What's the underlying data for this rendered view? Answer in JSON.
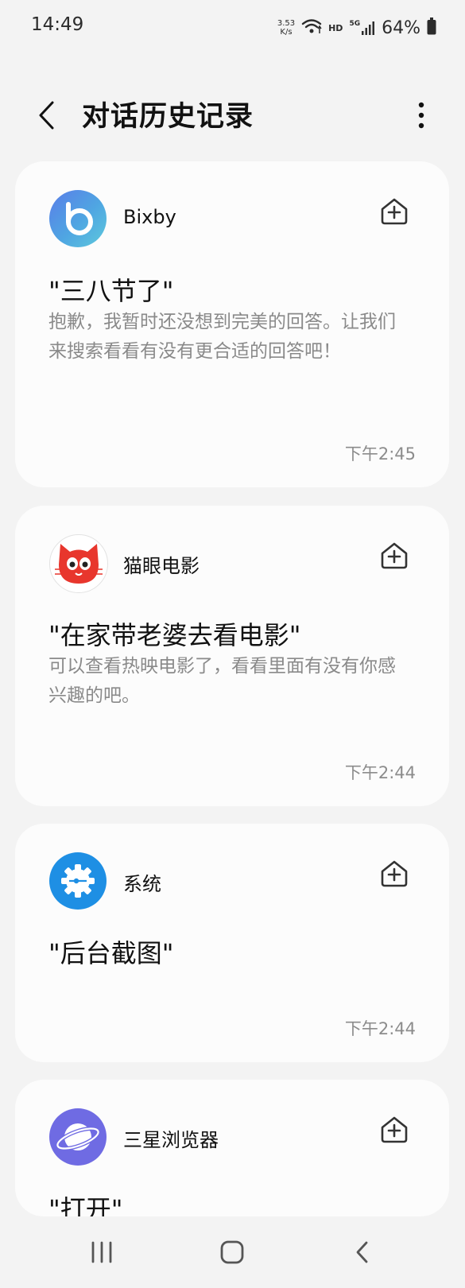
{
  "status_bar": {
    "time": "14:49",
    "net_speed_value": "3.53",
    "net_speed_unit": "K/s",
    "hd": "HD",
    "network": "5G",
    "battery": "64%"
  },
  "header": {
    "title": "对话历史记录"
  },
  "cards": [
    {
      "app_name": "Bixby",
      "icon": "bixby-icon",
      "query": "\"三八节了\"",
      "response": "抱歉，我暂时还没想到完美的回答。让我们来搜索看看有没有更合适的回答吧！",
      "time": "下午2:45"
    },
    {
      "app_name": "猫眼电影",
      "icon": "maoyan-cat-icon",
      "query": "\"在家带老婆去看电影\"",
      "response": "可以查看热映电影了，看看里面有没有你感兴趣的吧。",
      "time": "下午2:44"
    },
    {
      "app_name": "系统",
      "icon": "system-gear-icon",
      "query": "\"后台截图\"",
      "response": "",
      "time": "下午2:44"
    },
    {
      "app_name": "三星浏览器",
      "icon": "samsung-internet-icon",
      "query": "\"打开\"",
      "response": "",
      "time": ""
    }
  ],
  "colors": {
    "background": "#f3f3f3",
    "card": "#fcfcfc",
    "bixby_blue": "#4f8ce6",
    "maoyan_red": "#e8362d",
    "system_blue": "#1e8fe4",
    "browser_purple": "#6f6be3"
  }
}
